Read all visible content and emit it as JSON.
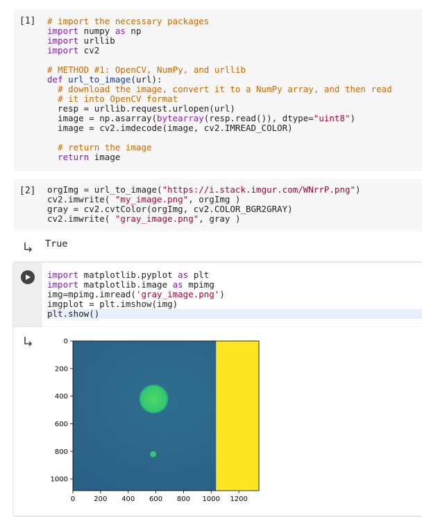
{
  "cells": [
    {
      "prompt": "[1]",
      "lines": [
        {
          "parts": [
            {
              "t": "# import the necessary packages",
              "c": "cm"
            }
          ]
        },
        {
          "parts": [
            {
              "t": "import",
              "c": "k"
            },
            {
              "t": " numpy ",
              "c": ""
            },
            {
              "t": "as",
              "c": "k"
            },
            {
              "t": " np",
              "c": ""
            }
          ]
        },
        {
          "parts": [
            {
              "t": "import",
              "c": "k"
            },
            {
              "t": " urllib",
              "c": ""
            }
          ]
        },
        {
          "parts": [
            {
              "t": "import",
              "c": "k"
            },
            {
              "t": " cv2",
              "c": ""
            }
          ]
        },
        {
          "parts": [
            {
              "t": "",
              "c": ""
            }
          ]
        },
        {
          "parts": [
            {
              "t": "# METHOD #1: OpenCV, NumPy, and urllib",
              "c": "cm"
            }
          ]
        },
        {
          "parts": [
            {
              "t": "def",
              "c": "k"
            },
            {
              "t": " ",
              "c": ""
            },
            {
              "t": "url_to_image",
              "c": "fn"
            },
            {
              "t": "(url):",
              "c": ""
            }
          ]
        },
        {
          "parts": [
            {
              "t": "  ",
              "c": ""
            },
            {
              "t": "# download the image, convert it to a NumPy array, and then read",
              "c": "cm"
            }
          ]
        },
        {
          "parts": [
            {
              "t": "  ",
              "c": ""
            },
            {
              "t": "# it into OpenCV format",
              "c": "cm"
            }
          ]
        },
        {
          "parts": [
            {
              "t": "  resp = urllib.request.urlopen(url)",
              "c": ""
            }
          ]
        },
        {
          "parts": [
            {
              "t": "  image = np.asarray(",
              "c": ""
            },
            {
              "t": "bytearray",
              "c": "bi"
            },
            {
              "t": "(resp.read()), dtype=",
              "c": ""
            },
            {
              "t": "\"uint8\"",
              "c": "st"
            },
            {
              "t": ")",
              "c": ""
            }
          ]
        },
        {
          "parts": [
            {
              "t": "  image = cv2.imdecode(image, cv2.IMREAD_COLOR)",
              "c": ""
            }
          ]
        },
        {
          "parts": [
            {
              "t": "",
              "c": ""
            }
          ]
        },
        {
          "parts": [
            {
              "t": "  ",
              "c": ""
            },
            {
              "t": "# return the image",
              "c": "cm"
            }
          ]
        },
        {
          "parts": [
            {
              "t": "  ",
              "c": ""
            },
            {
              "t": "return",
              "c": "k"
            },
            {
              "t": " image",
              "c": ""
            }
          ]
        }
      ]
    },
    {
      "prompt": "[2]",
      "lines": [
        {
          "parts": [
            {
              "t": "orgImg = url_to_image(",
              "c": ""
            },
            {
              "t": "\"https://i.stack.imgur.com/WNrrP.png\"",
              "c": "st"
            },
            {
              "t": ")",
              "c": ""
            }
          ]
        },
        {
          "parts": [
            {
              "t": "cv2.imwrite( ",
              "c": ""
            },
            {
              "t": "\"my_image.png\"",
              "c": "st"
            },
            {
              "t": ", orgImg )",
              "c": ""
            }
          ]
        },
        {
          "parts": [
            {
              "t": "gray = cv2.cvtColor(orgImg, cv2.COLOR_BGR2GRAY)",
              "c": ""
            }
          ]
        },
        {
          "parts": [
            {
              "t": "cv2.imwrite( ",
              "c": ""
            },
            {
              "t": "\"gray_image.png\"",
              "c": "st"
            },
            {
              "t": ", gray )",
              "c": ""
            }
          ]
        }
      ]
    },
    {
      "prompt": "",
      "lines": [
        {
          "parts": [
            {
              "t": "import",
              "c": "k"
            },
            {
              "t": " matplotlib.pyplot ",
              "c": ""
            },
            {
              "t": "as",
              "c": "k"
            },
            {
              "t": " plt",
              "c": ""
            }
          ]
        },
        {
          "parts": [
            {
              "t": "import",
              "c": "k"
            },
            {
              "t": " matplotlib.image ",
              "c": ""
            },
            {
              "t": "as",
              "c": "k"
            },
            {
              "t": " mpimg",
              "c": ""
            }
          ]
        },
        {
          "parts": [
            {
              "t": "img=mpimg.imread(",
              "c": ""
            },
            {
              "t": "'gray_image.png'",
              "c": "st"
            },
            {
              "t": ")",
              "c": ""
            }
          ]
        },
        {
          "parts": [
            {
              "t": "imgplot = plt.imshow(img)",
              "c": ""
            }
          ]
        },
        {
          "parts": [
            {
              "t": "plt.show()",
              "c": ""
            }
          ]
        }
      ]
    }
  ],
  "output2": "True",
  "icons": {
    "output": "output-arrow-icon",
    "run": "play-icon"
  },
  "colors": {
    "viridis_bg": "#2c6a8c",
    "viridis_blob": "#3fd36a",
    "yellow": "#fde725"
  },
  "chart_data": {
    "type": "heatmap",
    "xticks": [
      0,
      200,
      400,
      600,
      800,
      1000,
      1200
    ],
    "yticks": [
      0,
      200,
      400,
      600,
      800,
      1000
    ],
    "xlim": [
      0,
      1345
    ],
    "ylim": [
      0,
      1085
    ],
    "yellow_region_x": [
      1035,
      1345
    ],
    "blobs": [
      {
        "cx": 585,
        "cy": 420,
        "r": 105,
        "color": "#3fd36a"
      },
      {
        "cx": 580,
        "cy": 820,
        "r": 22,
        "color": "#30c870"
      }
    ]
  }
}
